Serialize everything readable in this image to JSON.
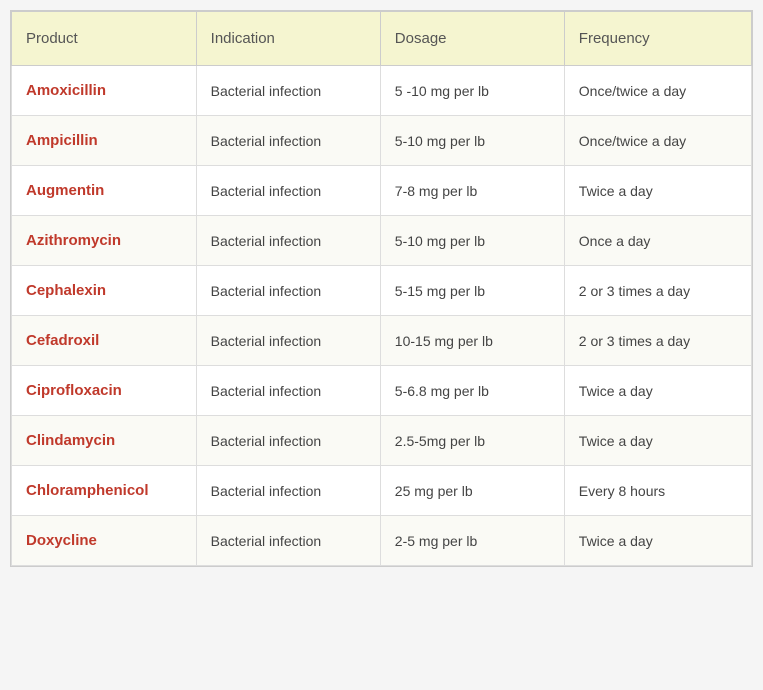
{
  "table": {
    "headers": {
      "product": "Product",
      "indication": "Indication",
      "dosage": "Dosage",
      "frequency": "Frequency"
    },
    "rows": [
      {
        "product": "Amoxicillin",
        "indication": "Bacterial infection",
        "dosage": "5 -10 mg per lb",
        "frequency": "Once/twice a day"
      },
      {
        "product": "Ampicillin",
        "indication": "Bacterial infection",
        "dosage": "5-10 mg per lb",
        "frequency": "Once/twice a day"
      },
      {
        "product": "Augmentin",
        "indication": "Bacterial infection",
        "dosage": "7-8 mg per lb",
        "frequency": "Twice a day"
      },
      {
        "product": "Azithromycin",
        "indication": "Bacterial infection",
        "dosage": "5-10 mg per lb",
        "frequency": "Once a day"
      },
      {
        "product": "Cephalexin",
        "indication": "Bacterial infection",
        "dosage": "5-15 mg per lb",
        "frequency": "2 or 3 times a day"
      },
      {
        "product": "Cefadroxil",
        "indication": "Bacterial infection",
        "dosage": "10-15 mg per lb",
        "frequency": "2 or 3 times a day"
      },
      {
        "product": "Ciprofloxacin",
        "indication": "Bacterial infection",
        "dosage": "5-6.8 mg per lb",
        "frequency": "Twice a day"
      },
      {
        "product": "Clindamycin",
        "indication": "Bacterial infection",
        "dosage": "2.5-5mg per lb",
        "frequency": "Twice a day"
      },
      {
        "product": "Chloramphenicol",
        "indication": "Bacterial infection",
        "dosage": "25 mg per lb",
        "frequency": "Every 8 hours"
      },
      {
        "product": "Doxycline",
        "indication": "Bacterial infection",
        "dosage": "2-5 mg per lb",
        "frequency": "Twice a day"
      }
    ]
  }
}
